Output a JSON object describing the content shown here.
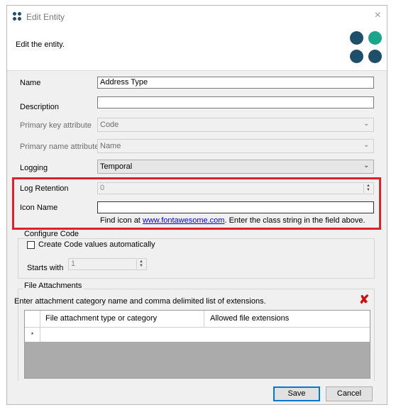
{
  "window": {
    "title": "Edit Entity",
    "close_glyph": "×"
  },
  "header": {
    "text": "Edit the entity."
  },
  "brand": {
    "colors": [
      "#1d4f6b",
      "#1aa58c",
      "#1d4f6b",
      "#1d4f6b"
    ]
  },
  "fields": {
    "name": {
      "label": "Name",
      "value": "Address Type"
    },
    "description": {
      "label": "Description",
      "value": ""
    },
    "primary_key": {
      "label": "Primary key attribute",
      "value": "Code"
    },
    "primary_name": {
      "label": "Primary name attribute",
      "value": "Name"
    },
    "logging": {
      "label": "Logging",
      "value": "Temporal"
    },
    "log_retention": {
      "label": "Log Retention",
      "value": "0"
    },
    "icon_name": {
      "label": "Icon Name",
      "value": ""
    }
  },
  "hint": {
    "prefix": "Find icon at ",
    "link": "www.fontawesome.com",
    "suffix": ". Enter the class string in the field above."
  },
  "configure_code": {
    "title": "Configure Code",
    "checkbox_label": "Create Code values automatically",
    "checked": false,
    "starts_with_label": "Starts with",
    "starts_with_value": "1"
  },
  "attachments": {
    "title": "File Attachments",
    "instructions": "Enter attachment category name and comma delimited list of extensions.",
    "columns": [
      "File attachment type or category",
      "Allowed file extensions"
    ],
    "new_row_marker": "*",
    "delete_glyph": "✘",
    "delete_color": "#cc1111"
  },
  "buttons": {
    "save": "Save",
    "cancel": "Cancel"
  }
}
